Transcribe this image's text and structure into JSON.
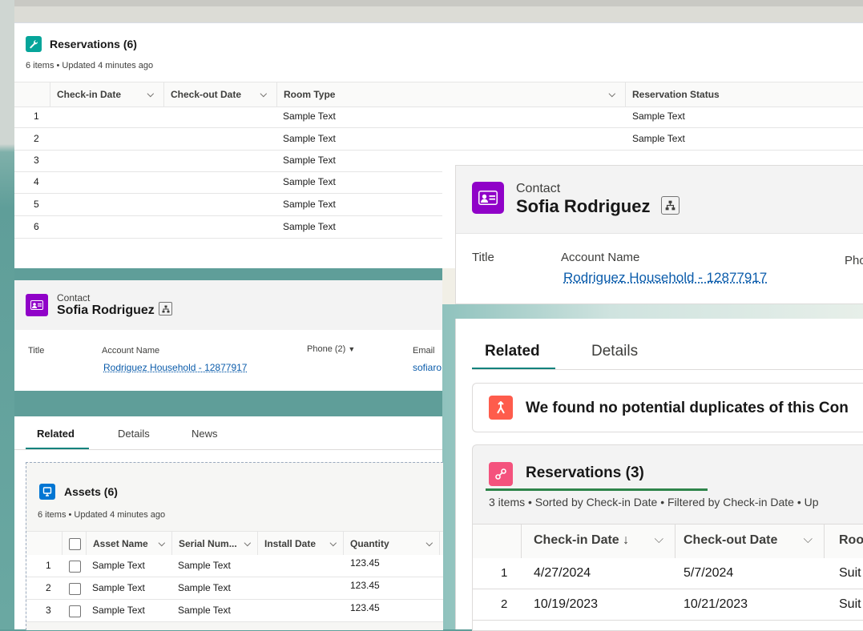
{
  "reservations_top": {
    "title": "Reservations (6)",
    "meta": "6 items • Updated 4 minutes ago",
    "columns": [
      "Check-in Date",
      "Check-out Date",
      "Room Type",
      "Reservation Status"
    ],
    "rows": [
      {
        "num": "1",
        "room": "Sample Text",
        "status": "Sample Text"
      },
      {
        "num": "2",
        "room": "Sample Text",
        "status": "Sample Text"
      },
      {
        "num": "3",
        "room": "Sample Text",
        "status": ""
      },
      {
        "num": "4",
        "room": "Sample Text",
        "status": ""
      },
      {
        "num": "5",
        "room": "Sample Text",
        "status": ""
      },
      {
        "num": "6",
        "room": "Sample Text",
        "status": ""
      }
    ]
  },
  "contact_small": {
    "type_label": "Contact",
    "name": "Sofia Rodriguez",
    "title_label": "Title",
    "account_label": "Account Name",
    "account_value": "Rodriguez Household - 12877917",
    "phone_label": "Phone (2)",
    "email_label": "Email",
    "email_value": "sofiaro"
  },
  "related_small": {
    "tabs": [
      "Related",
      "Details",
      "News"
    ],
    "assets_title": "Assets (6)",
    "assets_meta": "6 items • Updated 4 minutes ago",
    "columns": [
      "Asset Name",
      "Serial Num...",
      "Install Date",
      "Quantity"
    ],
    "rows": [
      {
        "num": "1",
        "name": "Sample Text",
        "serial": "Sample Text",
        "qty": "123.45"
      },
      {
        "num": "2",
        "name": "Sample Text",
        "serial": "Sample Text",
        "qty": "123.45"
      },
      {
        "num": "3",
        "name": "Sample Text",
        "serial": "Sample Text",
        "qty": "123.45"
      }
    ]
  },
  "contact_big": {
    "type_label": "Contact",
    "name": "Sofia Rodriguez",
    "title_label": "Title",
    "account_label": "Account Name",
    "account_value": "Rodriguez Household - 12877917",
    "phone_label": "Pho"
  },
  "related_big": {
    "tabs": [
      "Related",
      "Details"
    ],
    "duplicates_text": "We found no potential duplicates of this Con",
    "reservations_title": "Reservations (3)",
    "reservations_meta": "3 items • Sorted by Check-in Date • Filtered by Check-in Date • Up",
    "columns": [
      "Check-in Date ↓",
      "Check-out Date",
      "Roo"
    ],
    "rows": [
      {
        "num": "1",
        "checkin": "4/27/2024",
        "checkout": "5/7/2024",
        "room": "Suit"
      },
      {
        "num": "2",
        "checkin": "10/19/2023",
        "checkout": "10/21/2023",
        "room": "Suit"
      }
    ]
  },
  "colors": {
    "teal_icon": "#06a59a",
    "contact_purple": "#9002c8",
    "blue_icon": "#0176d3",
    "orange_icon": "#fe5c4c",
    "pink_icon": "#f4527d",
    "green_underline": "#2e844a",
    "link": "#0b5cab"
  },
  "icons": [
    "wrench-icon",
    "contact-card-icon",
    "hierarchy-icon",
    "asset-icon",
    "merge-icon",
    "link-icon",
    "chevron-down-icon",
    "sort-down-icon"
  ]
}
